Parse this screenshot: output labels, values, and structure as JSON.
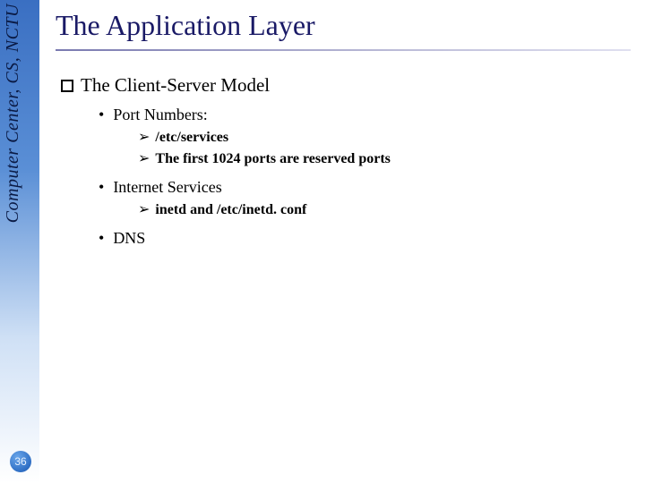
{
  "meta": {
    "source_label": "Computer Center, CS, NCTU",
    "page_number": "36"
  },
  "title": "The Application Layer",
  "outline": {
    "lvl1": {
      "text": "The Client-Server Model"
    },
    "items": [
      {
        "label": "Port Numbers:",
        "sub": [
          {
            "text": "/etc/services"
          },
          {
            "text": "The first 1024 ports are reserved ports"
          }
        ]
      },
      {
        "label": "Internet Services",
        "sub": [
          {
            "text": "inetd and /etc/inetd. conf"
          }
        ]
      },
      {
        "label": "DNS",
        "sub": []
      }
    ]
  }
}
